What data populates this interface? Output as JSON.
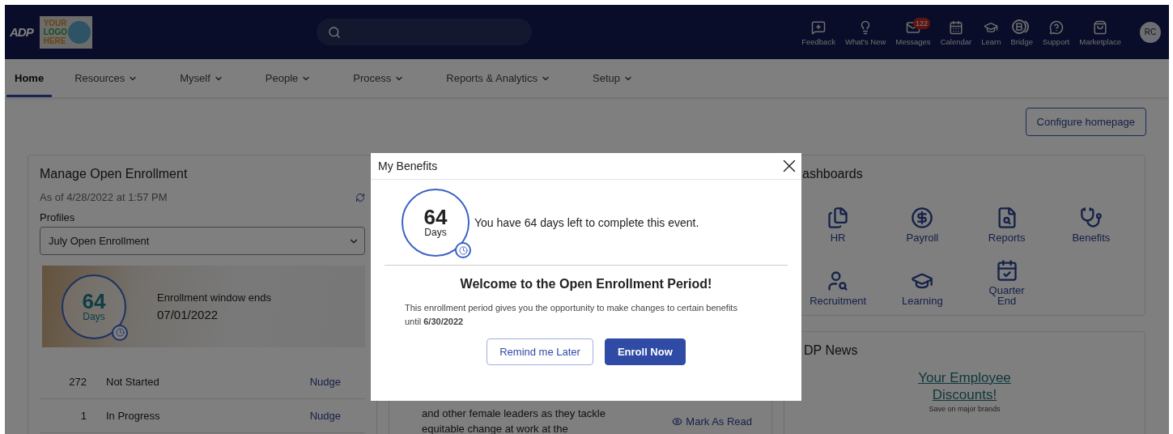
{
  "header": {
    "brand": "ADP",
    "logo_lines": [
      "YOUR",
      "LOGO",
      "HERE"
    ],
    "tools": [
      {
        "kind": "feedback",
        "label": "Feedback"
      },
      {
        "kind": "whatsnew",
        "label": "What's New"
      },
      {
        "kind": "messages",
        "label": "Messages",
        "badge": "122"
      },
      {
        "kind": "calendar",
        "label": "Calendar"
      },
      {
        "kind": "learn",
        "label": "Learn"
      },
      {
        "kind": "bridge",
        "label": "Bridge"
      },
      {
        "kind": "support",
        "label": "Support"
      },
      {
        "kind": "marketplace",
        "label": "Marketplace"
      }
    ],
    "avatar": "RC"
  },
  "nav": [
    {
      "label": "Home",
      "selected": true,
      "dropdown": false
    },
    {
      "label": "Resources",
      "selected": false,
      "dropdown": true
    },
    {
      "label": "Myself",
      "selected": false,
      "dropdown": true
    },
    {
      "label": "People",
      "selected": false,
      "dropdown": true
    },
    {
      "label": "Process",
      "selected": false,
      "dropdown": true
    },
    {
      "label": "Reports & Analytics",
      "selected": false,
      "dropdown": true
    },
    {
      "label": "Setup",
      "selected": false,
      "dropdown": true
    }
  ],
  "configure_button": "Configure homepage",
  "enrollment_card": {
    "title": "Manage Open Enrollment",
    "as_of": "As of 4/28/2022 at 1:57 PM",
    "profiles_label": "Profiles",
    "profile_value": "July Open Enrollment",
    "days": "64",
    "days_unit": "Days",
    "window_label": "Enrollment window ends",
    "window_date": "07/01/2022",
    "rows": [
      {
        "count": "272",
        "status": "Not Started",
        "action": "Nudge"
      },
      {
        "count": "1",
        "status": "In Progress",
        "action": "Nudge"
      }
    ]
  },
  "news_card": {
    "lines": [
      "and other female leaders as they tackle",
      "equitable change at work at the"
    ],
    "mark_read": "Mark As Read"
  },
  "dashboards_card": {
    "title": "ashboards",
    "items": [
      {
        "kind": "hr",
        "label": "HR"
      },
      {
        "kind": "payroll",
        "label": "Payroll"
      },
      {
        "kind": "reports",
        "label": "Reports"
      },
      {
        "kind": "benefits",
        "label": "Benefits"
      },
      {
        "kind": "recruitment",
        "label": "Recruitment"
      },
      {
        "kind": "learning",
        "label": "Learning"
      },
      {
        "kind": "quarter",
        "label": "Quarter End"
      }
    ]
  },
  "adp_news_card": {
    "title": "DP News",
    "promo_link": "Your Employee Discounts!",
    "promo_sub": "Save on major brands"
  },
  "modal": {
    "title": "My Benefits",
    "days": "64",
    "days_unit": "Days",
    "message": "You have 64 days left to complete this event.",
    "heading": "Welcome to the Open Enrollment Period!",
    "body": "This enrollment period gives you the opportunity to make changes to certain benefits until **6/30/2022**",
    "buttons": [
      {
        "label": "Remind me Later",
        "kind": "secondary"
      },
      {
        "label": "Enroll Now",
        "kind": "primary"
      }
    ]
  }
}
